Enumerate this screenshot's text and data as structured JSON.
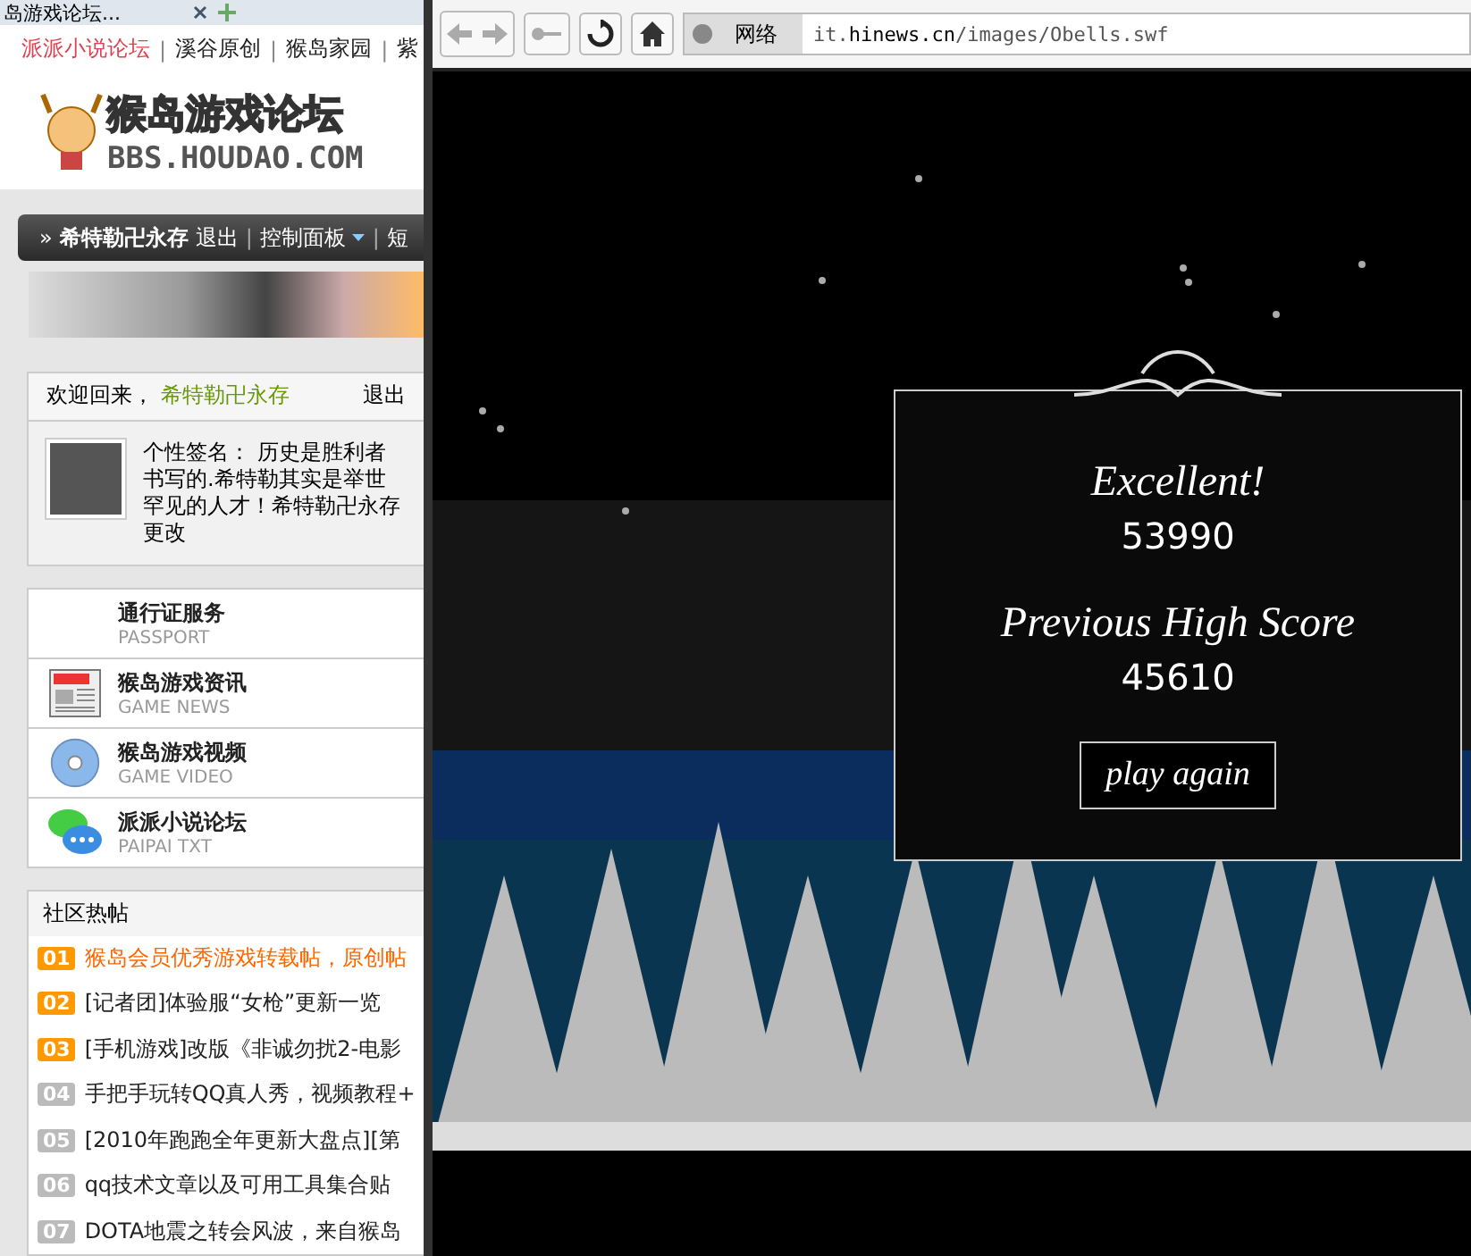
{
  "browser_tab": {
    "title": "岛游戏论坛..."
  },
  "top_nav": [
    {
      "kind": "link",
      "label": "派派小说论坛",
      "selected": true
    },
    {
      "kind": "separator",
      "label": "|"
    },
    {
      "kind": "link",
      "label": "溪谷原创",
      "selected": false
    },
    {
      "kind": "separator",
      "label": "|"
    },
    {
      "kind": "link",
      "label": "猴岛家园",
      "selected": false
    },
    {
      "kind": "separator",
      "label": "|"
    },
    {
      "kind": "link",
      "label": "紫",
      "selected": false
    }
  ],
  "logo": {
    "title": "猴岛游戏论坛",
    "subtitle": "BBS.HOUDAO.COM"
  },
  "user_bar": {
    "prefix": "»",
    "username": "希特勒卍永存",
    "links": [
      {
        "label": "退出",
        "kind": "link"
      },
      {
        "label": "|",
        "kind": "separator"
      },
      {
        "label": "控制面板",
        "kind": "dropdown"
      },
      {
        "label": "|",
        "kind": "separator"
      },
      {
        "label": "短",
        "kind": "link"
      }
    ]
  },
  "welcome": {
    "greeting": "欢迎回来，",
    "username": "希特勒卍永存",
    "logout": "退出",
    "signature_label": "个性签名：",
    "signature": "历史是胜利者书写的.希特勒其实是举世罕见的人才！希特勒卍永存",
    "edit": "更改"
  },
  "services": [
    {
      "title": "通行证服务",
      "subtitle": "PASSPORT",
      "kind": "none"
    },
    {
      "title": "猴岛游戏资讯",
      "subtitle": "GAME NEWS",
      "kind": "news"
    },
    {
      "title": "猴岛游戏视频",
      "subtitle": "GAME VIDEO",
      "kind": "disc"
    },
    {
      "title": "派派小说论坛",
      "subtitle": "PAIPAI TXT",
      "kind": "chat"
    }
  ],
  "hot_posts": {
    "title": "社区热帖",
    "items": [
      {
        "rank": "01",
        "title": "猴岛会员优秀游戏转载帖，原创帖",
        "hot": true,
        "selected": true
      },
      {
        "rank": "02",
        "title": "[记者团]体验服“女枪”更新一览",
        "hot": true,
        "selected": false
      },
      {
        "rank": "03",
        "title": "[手机游戏]改版《非诚勿扰2-电影",
        "hot": true,
        "selected": false
      },
      {
        "rank": "04",
        "title": "手把手玩转QQ真人秀，视频教程+",
        "hot": false,
        "selected": false
      },
      {
        "rank": "05",
        "title": "[2010年跑跑全年更新大盘点][第",
        "hot": false,
        "selected": false
      },
      {
        "rank": "06",
        "title": "qq技术文章以及可用工具集合贴",
        "hot": false,
        "selected": false
      },
      {
        "rank": "07",
        "title": "DOTA地震之转会风波，来自猴岛",
        "hot": false,
        "selected": false
      }
    ]
  },
  "browser": {
    "zone": "网络",
    "url": "it.**hinews.cn**/images/Obells.swf"
  },
  "game": {
    "result": "Excellent!",
    "score": "53990",
    "high_label": "Previous High Score",
    "high_score": "45610",
    "button": "play again"
  }
}
